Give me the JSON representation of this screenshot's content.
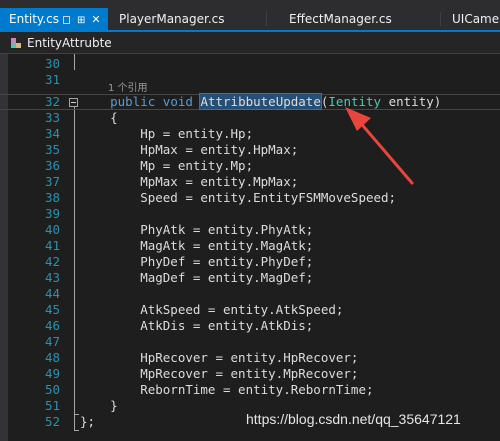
{
  "tabs": {
    "items": [
      {
        "label": "Entity.cs",
        "active": true
      },
      {
        "label": "PlayerManager.cs",
        "active": false
      },
      {
        "label": "EffectManager.cs",
        "active": false
      },
      {
        "label": "UICame",
        "active": false
      }
    ]
  },
  "navbar": {
    "class_label": "EntityAttrubte"
  },
  "editor": {
    "reference_hint": "1 个引用",
    "selected_method": "AttribbuteUpdate",
    "lines": [
      {
        "num": "30",
        "text": ""
      },
      {
        "num": "31",
        "text": ""
      },
      {
        "num": "32",
        "text": "    public void AttribbuteUpdate(Ientity entity)"
      },
      {
        "num": "33",
        "text": "    {"
      },
      {
        "num": "34",
        "text": "        Hp = entity.Hp;"
      },
      {
        "num": "35",
        "text": "        HpMax = entity.HpMax;"
      },
      {
        "num": "36",
        "text": "        Mp = entity.Mp;"
      },
      {
        "num": "37",
        "text": "        MpMax = entity.MpMax;"
      },
      {
        "num": "38",
        "text": "        Speed = entity.EntityFSMMoveSpeed;"
      },
      {
        "num": "39",
        "text": ""
      },
      {
        "num": "40",
        "text": "        PhyAtk = entity.PhyAtk;"
      },
      {
        "num": "41",
        "text": "        MagAtk = entity.MagAtk;"
      },
      {
        "num": "42",
        "text": "        PhyDef = entity.PhyDef;"
      },
      {
        "num": "43",
        "text": "        MagDef = entity.MagDef;"
      },
      {
        "num": "44",
        "text": ""
      },
      {
        "num": "45",
        "text": "        AtkSpeed = entity.AtkSpeed;"
      },
      {
        "num": "46",
        "text": "        AtkDis = entity.AtkDis;"
      },
      {
        "num": "47",
        "text": ""
      },
      {
        "num": "48",
        "text": "        HpRecover = entity.HpRecover;"
      },
      {
        "num": "49",
        "text": "        MpRecover = entity.MpRecover;"
      },
      {
        "num": "50",
        "text": "        RebornTime = entity.RebornTime;"
      },
      {
        "num": "51",
        "text": "    }"
      },
      {
        "num": "52",
        "text": "};"
      }
    ]
  },
  "watermark": "https://blog.csdn.net/qq_35647121",
  "colors": {
    "active_tab": "#007acc",
    "keyword": "#569cd6",
    "type": "#4ec9b0",
    "line_number": "#2b91af",
    "annotation_arrow": "#e8453c"
  },
  "icons": {
    "pin": "pin-icon",
    "close": "close-icon",
    "class": "class-icon",
    "collapse": "collapse-icon"
  }
}
